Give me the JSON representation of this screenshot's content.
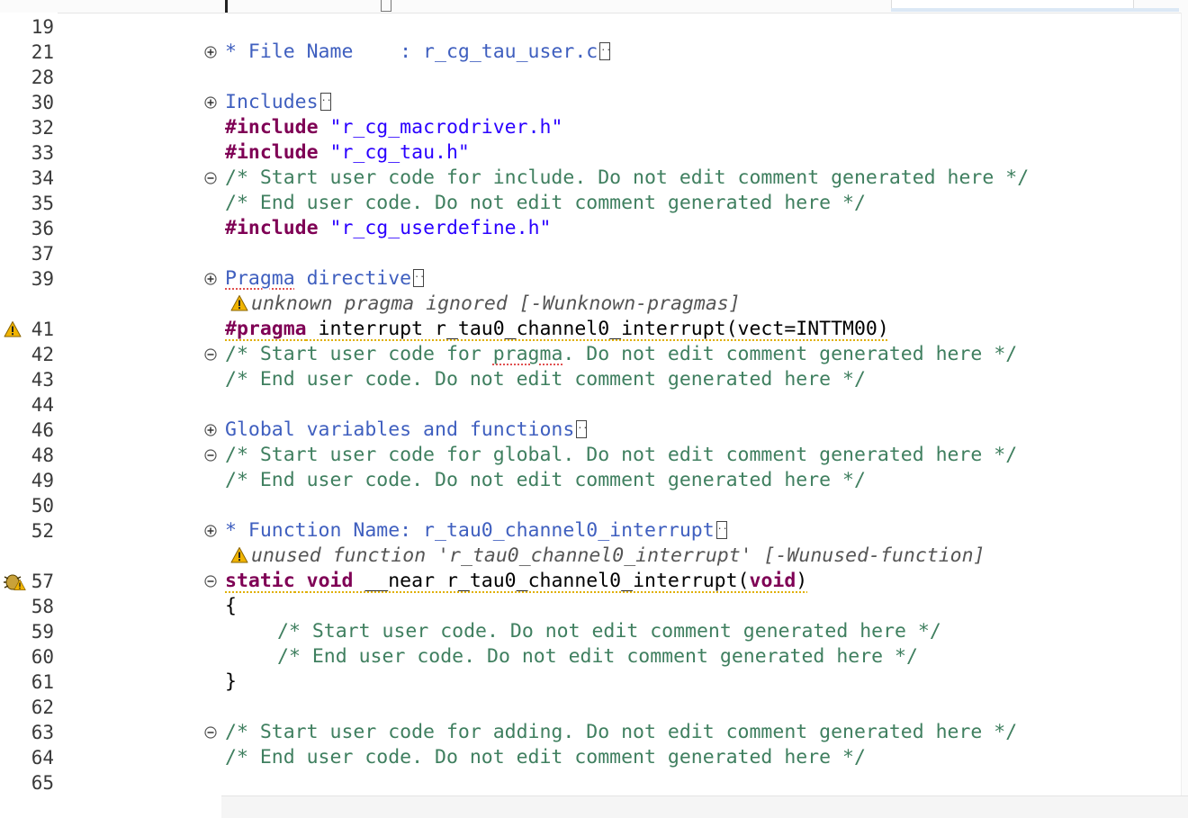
{
  "editor": {
    "language": "C",
    "lines": [
      {
        "num": "19"
      },
      {
        "num": "21",
        "fold": "plus",
        "segs": [
          {
            "c": "folded",
            "t": "* File Name    : r_cg_tau_user.c"
          }
        ],
        "ellipsis": true
      },
      {
        "num": "28"
      },
      {
        "num": "30",
        "fold": "plus",
        "segs": [
          {
            "c": "folded",
            "t": "Includes"
          }
        ],
        "ellipsis": true
      },
      {
        "num": "32",
        "segs": [
          {
            "c": "kw",
            "t": "#include"
          },
          {
            "c": "plain",
            "t": " "
          },
          {
            "c": "str",
            "t": "\"r_cg_macrodriver.h\""
          }
        ]
      },
      {
        "num": "33",
        "segs": [
          {
            "c": "kw",
            "t": "#include"
          },
          {
            "c": "plain",
            "t": " "
          },
          {
            "c": "str",
            "t": "\"r_cg_tau.h\""
          }
        ]
      },
      {
        "num": "34",
        "fold": "minus",
        "segs": [
          {
            "c": "cmt",
            "t": "/* Start user code for include. Do not edit comment generated here */"
          }
        ]
      },
      {
        "num": "35",
        "segs": [
          {
            "c": "cmt",
            "t": "/* End user code. Do not edit comment generated here */"
          }
        ]
      },
      {
        "num": "36",
        "segs": [
          {
            "c": "kw",
            "t": "#include"
          },
          {
            "c": "plain",
            "t": " "
          },
          {
            "c": "str",
            "t": "\"r_cg_userdefine.h\""
          }
        ]
      },
      {
        "num": "37"
      },
      {
        "num": "39",
        "fold": "plus",
        "segs": [
          {
            "c": "folded wavy-red",
            "t": "Pragma"
          },
          {
            "c": "folded",
            "t": " directive"
          }
        ],
        "ellipsis": true
      },
      {
        "num": "",
        "annotation": true,
        "segs": [
          {
            "c": "ghost",
            "t": "unknown pragma ignored [-Wunknown-pragmas]"
          }
        ]
      },
      {
        "num": "41",
        "warning": true,
        "segs": [
          {
            "c": "kw wavy-y",
            "t": "#pragma"
          },
          {
            "c": "plain wavy-y",
            "t": " interrupt r_tau0_channel0_interrupt(vect=INTTM00)"
          }
        ]
      },
      {
        "num": "42",
        "fold": "minus",
        "segs": [
          {
            "c": "cmt",
            "t": "/* Start user code for "
          },
          {
            "c": "cmt wavy-red",
            "t": "pragma"
          },
          {
            "c": "cmt",
            "t": ". Do not edit comment generated here */"
          }
        ]
      },
      {
        "num": "43",
        "segs": [
          {
            "c": "cmt",
            "t": "/* End user code. Do not edit comment generated here */"
          }
        ]
      },
      {
        "num": "44"
      },
      {
        "num": "46",
        "fold": "plus",
        "segs": [
          {
            "c": "folded",
            "t": "Global variables and functions"
          }
        ],
        "ellipsis": true
      },
      {
        "num": "48",
        "fold": "minus",
        "segs": [
          {
            "c": "cmt",
            "t": "/* Start user code for global. Do not edit comment generated here */"
          }
        ]
      },
      {
        "num": "49",
        "segs": [
          {
            "c": "cmt",
            "t": "/* End user code. Do not edit comment generated here */"
          }
        ]
      },
      {
        "num": "50"
      },
      {
        "num": "52",
        "fold": "plus",
        "segs": [
          {
            "c": "folded",
            "t": "* Function Name: r_tau0_channel0_interrupt"
          }
        ],
        "ellipsis": true
      },
      {
        "num": "",
        "annotation": true,
        "segs": [
          {
            "c": "ghost",
            "t": "unused function 'r_tau0_channel0_interrupt' [-Wunused-function]"
          }
        ]
      },
      {
        "num": "57",
        "bug": true,
        "fold": "minus",
        "segs": [
          {
            "c": "kw wavy-y",
            "t": "static"
          },
          {
            "c": "plain wavy-y",
            "t": " "
          },
          {
            "c": "kw wavy-y",
            "t": "void"
          },
          {
            "c": "plain wavy-y",
            "t": " __near r_tau0_channel0_interrupt("
          },
          {
            "c": "kw wavy-y",
            "t": "void"
          },
          {
            "c": "plain wavy-y",
            "t": ")"
          }
        ]
      },
      {
        "num": "58",
        "segs": [
          {
            "c": "plain",
            "t": "{"
          }
        ]
      },
      {
        "num": "59",
        "indent": 1,
        "segs": [
          {
            "c": "cmt",
            "t": "/* Start user code. Do not edit comment generated here */"
          }
        ]
      },
      {
        "num": "60",
        "indent": 1,
        "segs": [
          {
            "c": "cmt",
            "t": "/* End user code. Do not edit comment generated here */"
          }
        ]
      },
      {
        "num": "61",
        "segs": [
          {
            "c": "plain",
            "t": "}"
          }
        ]
      },
      {
        "num": "62"
      },
      {
        "num": "63",
        "fold": "minus",
        "segs": [
          {
            "c": "cmt",
            "t": "/* Start user code for adding. Do not edit comment generated here */"
          }
        ]
      },
      {
        "num": "64",
        "segs": [
          {
            "c": "cmt",
            "t": "/* End user code. Do not edit comment generated here */"
          }
        ]
      },
      {
        "num": "65"
      }
    ]
  },
  "icons": {
    "fold_plus": "expand-fold-icon",
    "fold_minus": "collapse-fold-icon",
    "warning": "warning-icon",
    "bug": "bug-warning-icon"
  },
  "colors": {
    "keyword": "#7f0055",
    "string": "#2a00ff",
    "comment": "#3f7f5f",
    "folded": "#3f5fbf",
    "warning": "#f0b400"
  }
}
